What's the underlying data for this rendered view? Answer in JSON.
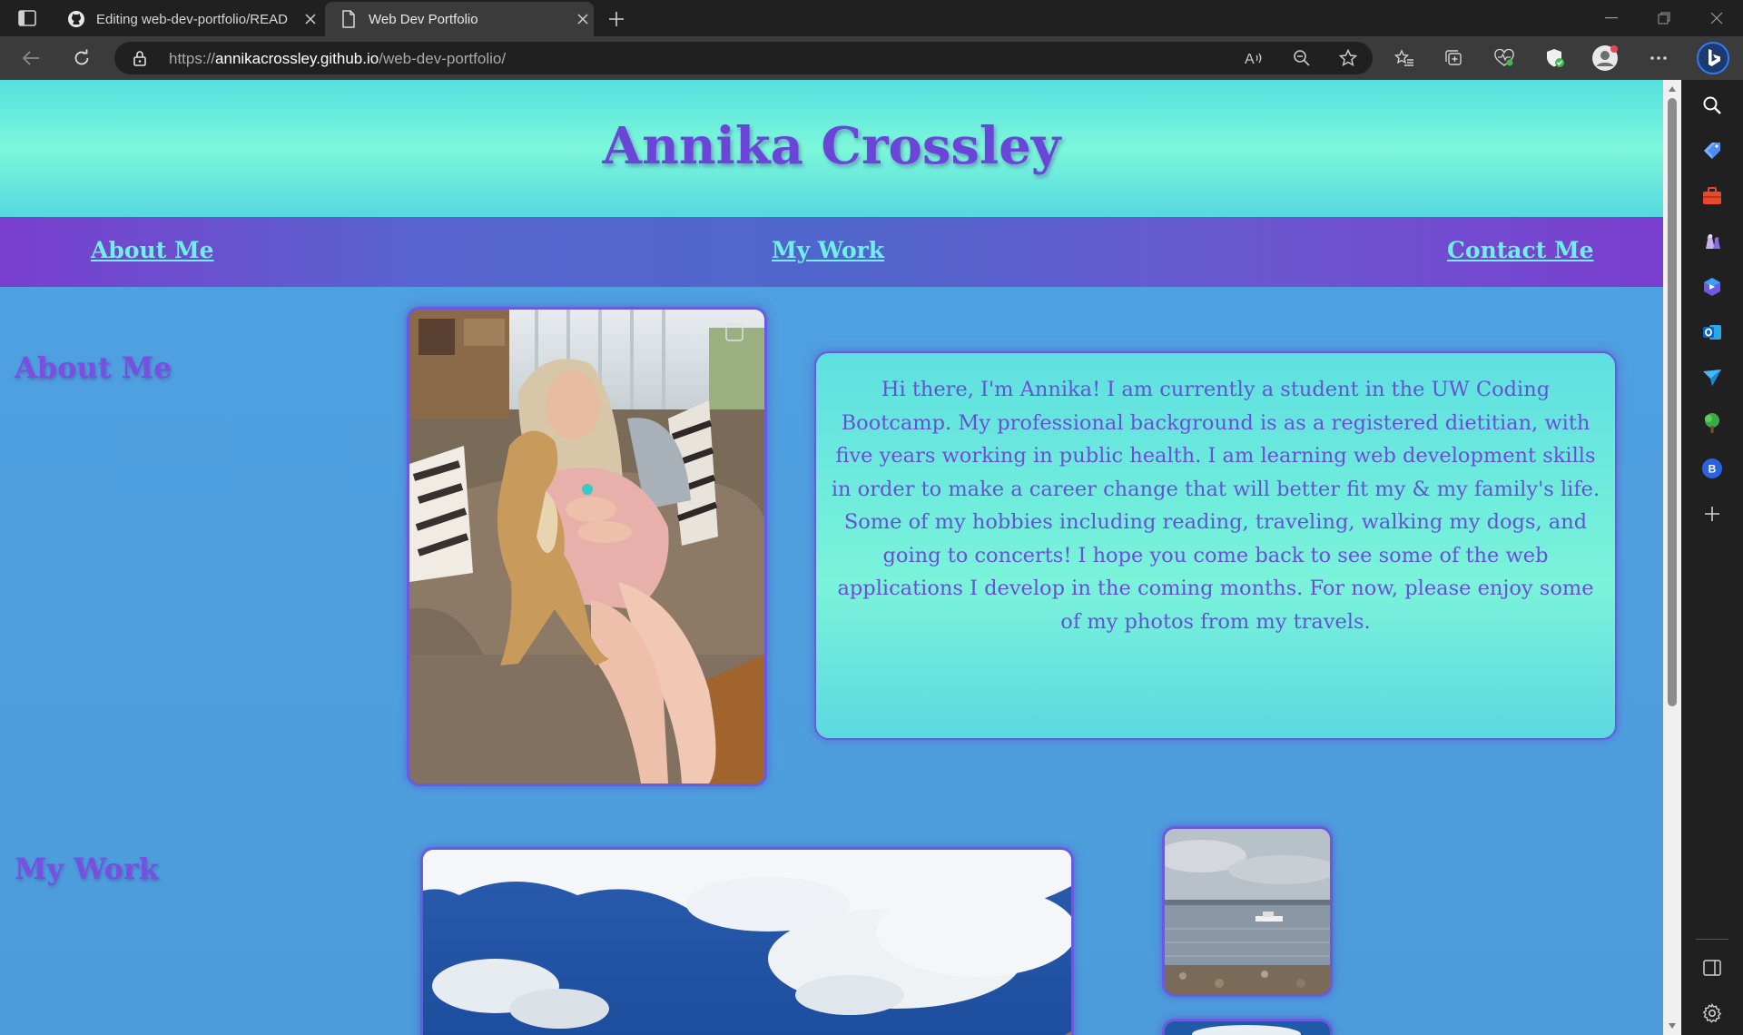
{
  "browser": {
    "tabs": [
      {
        "title": "Editing web-dev-portfolio/READ",
        "active": false,
        "icon": "github-icon"
      },
      {
        "title": "Web Dev Portfolio",
        "active": true,
        "icon": "page-icon"
      }
    ],
    "url_prefix": "https://",
    "url_host": "annikacrossley.github.io",
    "url_path": "/web-dev-portfolio/"
  },
  "site": {
    "title": "Annika Crossley",
    "nav": [
      {
        "label": "About Me"
      },
      {
        "label": "My Work"
      },
      {
        "label": "Contact Me"
      }
    ],
    "about": {
      "heading": "About Me",
      "bio": "Hi there, I'm Annika! I am currently a student in the UW Coding Bootcamp. My professional background is as a registered dietitian, with five years working in public health. I am learning web development skills in order to make a career change that will better fit my & my family's life. Some of my hobbies including reading, traveling, walking my dogs, and going to concerts! I hope you come back to see some of the web applications I develop in the coming months. For now, please enjoy some of my photos from my travels."
    },
    "work": {
      "heading": "My Work"
    }
  },
  "colors": {
    "accent_purple": "#6a45d8",
    "nav_link": "#6ff0e6",
    "header_teal": "#7cf7da",
    "page_blue": "#4fa0e0"
  }
}
